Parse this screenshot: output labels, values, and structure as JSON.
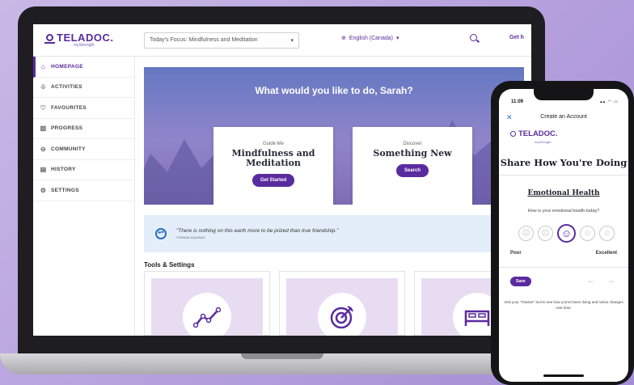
{
  "app": {
    "brand": "TELADOC.",
    "brand_sub": "myStrength"
  },
  "topbar": {
    "focus_label": "Today's Focus: Mindfulness and Meditation",
    "focus_chevron": "▾",
    "language": "English (Canada)",
    "language_chevron": "▾",
    "get_help": "Get h"
  },
  "sidebar": {
    "items": [
      {
        "label": "HOMEPAGE",
        "icon": "home-icon",
        "glyph": "⌂"
      },
      {
        "label": "ACTIVITIES",
        "icon": "activities-icon",
        "glyph": "♧"
      },
      {
        "label": "FAVOURITES",
        "icon": "heart-icon",
        "glyph": "♡"
      },
      {
        "label": "PROGRESS",
        "icon": "progress-icon",
        "glyph": "▥"
      },
      {
        "label": "COMMUNITY",
        "icon": "community-icon",
        "glyph": "⊖"
      },
      {
        "label": "HISTORY",
        "icon": "history-icon",
        "glyph": "▤"
      },
      {
        "label": "SETTINGS",
        "icon": "gear-icon",
        "glyph": "⚙"
      }
    ]
  },
  "hero": {
    "title": "What would you like to do, Sarah?",
    "cards": [
      {
        "kicker": "Guide Me",
        "heading": "Mindfulness and Meditation",
        "button": "Get Started"
      },
      {
        "kicker": "Discover",
        "heading": "Something New",
        "button": "Search"
      }
    ]
  },
  "quote": {
    "icon_glyph": "❝❞",
    "text": "\"There is nothing on this earth more to be prized than true friendship.\"",
    "author": "THOMAS AQUINAS"
  },
  "tools": {
    "title": "Tools & Settings"
  },
  "phone": {
    "time": "11:09",
    "status": "▴▴ ◠ ▭",
    "header": "Create an Account",
    "close_glyph": "✕",
    "brand": "TELADOC.",
    "brand_sub": "myStrength",
    "title": "Share How You're Doing",
    "section": "Emotional Health",
    "question": "How is your emotional health today?",
    "faces": [
      "☹",
      "☹",
      "☺",
      "☺",
      "☺"
    ],
    "selected_face": 3,
    "poor": "Poor",
    "excellent": "Excellent",
    "save": "Save",
    "arrows": "← →",
    "note": "Visit your \"Tracker\" tool to see how you've been doing and notice changes over time."
  },
  "colors": {
    "accent": "#5a2b9e",
    "quote_bg": "#e4eefb",
    "tile_bg": "#e8dcf2"
  }
}
